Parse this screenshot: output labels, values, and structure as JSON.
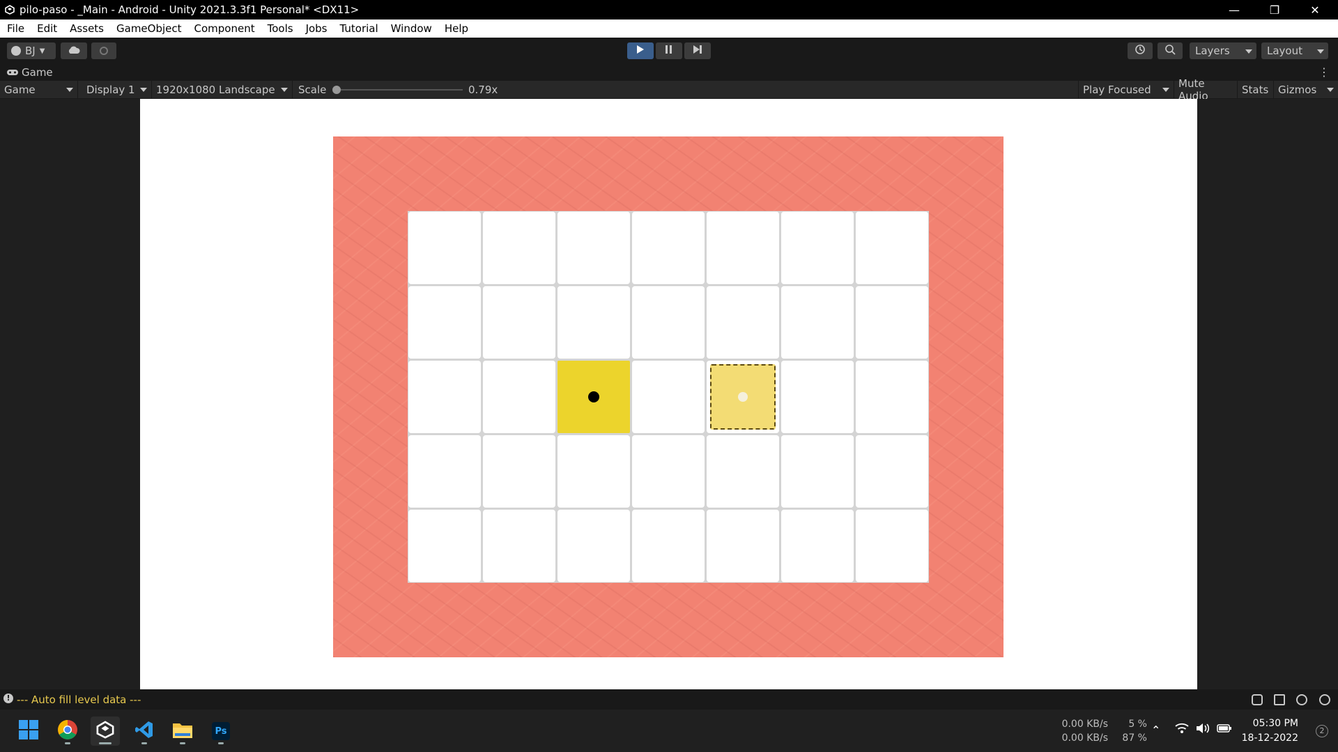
{
  "window": {
    "title": "pilo-paso - _Main - Android - Unity 2021.3.3f1 Personal* <DX11>"
  },
  "menu": [
    "File",
    "Edit",
    "Assets",
    "GameObject",
    "Component",
    "Tools",
    "Jobs",
    "Tutorial",
    "Window",
    "Help"
  ],
  "toolbar": {
    "account": "BJ",
    "layers": "Layers",
    "layout": "Layout"
  },
  "tab": {
    "label": "Game"
  },
  "game_toolbar": {
    "mode": "Game",
    "display": "Display 1",
    "resolution": "1920x1080 Landscape",
    "scale_label": "Scale",
    "scale_value": "0.79x",
    "scale_fraction": 0.0,
    "play_focused": "Play Focused",
    "mute": "Mute Audio",
    "stats": "Stats",
    "gizmos": "Gizmos"
  },
  "board": {
    "rows": 5,
    "cols": 7,
    "tile": {
      "row": 2,
      "col": 2
    },
    "target": {
      "row": 2,
      "col": 4
    }
  },
  "colors": {
    "border": "#f28272",
    "tile": "#ecd42c",
    "target": "#f3dc74",
    "accent": "#3a5e8c"
  },
  "status": {
    "message": "--- Auto fill level data ---"
  },
  "taskbar": {
    "net_up": "0.00 KB/s",
    "net_down": "0.00 KB/s",
    "cpu": "5 %",
    "mem": "87 %",
    "time": "05:30 PM",
    "date": "18-12-2022",
    "notifications": "2"
  }
}
